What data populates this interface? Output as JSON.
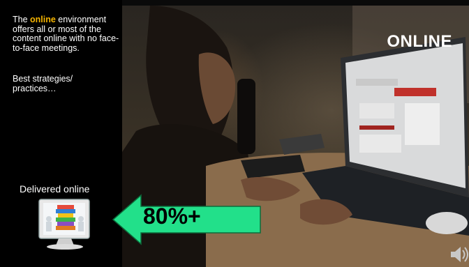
{
  "slide": {
    "title": "ONLINE",
    "description": {
      "prefix": "The ",
      "highlight": "online",
      "suffix": " environment offers all or most of the content  online with no face-to-face meetings."
    },
    "strategies": "Best strategies/ practices…",
    "delivered_label": "Delivered online",
    "arrow_text": "80%+",
    "colors": {
      "highlight": "#f5b400",
      "arrow_fill": "#22e08a"
    }
  }
}
